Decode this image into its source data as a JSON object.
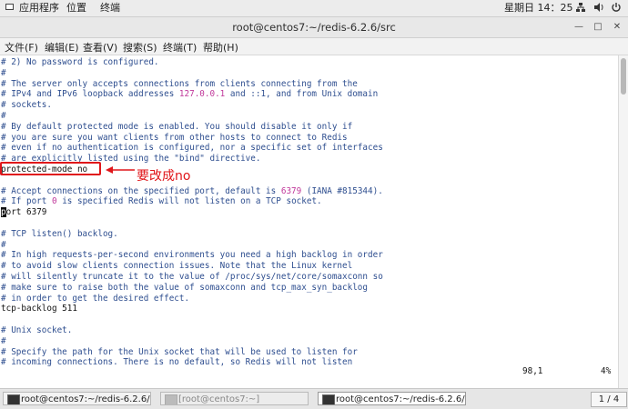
{
  "topbar": {
    "apps_label": "应用程序",
    "places_label": "位置",
    "terminal_label": "终端",
    "clock": "星期日 14：25"
  },
  "window": {
    "title": "root@centos7:~/redis-6.2.6/src"
  },
  "menu": [
    "文件(F)",
    "编辑(E)",
    "查看(V)",
    "搜索(S)",
    "终端(T)",
    "帮助(H)"
  ],
  "lines": [
    {
      "pre": "# 2) No password is configured.",
      "num": "",
      "post": ""
    },
    {
      "pre": "#",
      "num": "",
      "post": ""
    },
    {
      "pre": "# The server only accepts connections from clients connecting from the",
      "num": "",
      "post": ""
    },
    {
      "pre": "# IPv4 and IPv6 loopback addresses ",
      "num": "127.0.0.1",
      "post": " and ::1, and from Unix domain"
    },
    {
      "pre": "# sockets.",
      "num": "",
      "post": ""
    },
    {
      "pre": "#",
      "num": "",
      "post": ""
    },
    {
      "pre": "# By default protected mode is enabled. You should disable it only if",
      "num": "",
      "post": ""
    },
    {
      "pre": "# you are sure you want clients from other hosts to connect to Redis",
      "num": "",
      "post": ""
    },
    {
      "pre": "# even if no authentication is configured, nor a specific set of interfaces",
      "num": "",
      "post": ""
    },
    {
      "pre": "# are explicitly listed using the \"bind\" directive.",
      "num": "",
      "post": ""
    },
    {
      "pre": "protected-mode no",
      "num": "",
      "post": "",
      "black": true
    },
    {
      "pre": "",
      "num": "",
      "post": ""
    },
    {
      "pre": "# Accept connections on the specified port, default is ",
      "num": "6379",
      "post": " (IANA #815344)."
    },
    {
      "pre": "# If port ",
      "num": "0",
      "post": " is specified Redis will not listen on a TCP socket."
    },
    {
      "pre": "port 6379",
      "num": "",
      "post": "",
      "black": true,
      "cursor": true
    },
    {
      "pre": "",
      "num": "",
      "post": ""
    },
    {
      "pre": "# TCP listen() backlog.",
      "num": "",
      "post": ""
    },
    {
      "pre": "#",
      "num": "",
      "post": ""
    },
    {
      "pre": "# In high requests-per-second environments you need a high backlog in order",
      "num": "",
      "post": ""
    },
    {
      "pre": "# to avoid slow clients connection issues. Note that the Linux kernel",
      "num": "",
      "post": ""
    },
    {
      "pre": "# will silently truncate it to the value of /proc/sys/net/core/somaxconn so",
      "num": "",
      "post": ""
    },
    {
      "pre": "# make sure to raise both the value of somaxconn and tcp_max_syn_backlog",
      "num": "",
      "post": ""
    },
    {
      "pre": "# in order to get the desired effect.",
      "num": "",
      "post": ""
    },
    {
      "pre": "tcp-backlog 511",
      "num": "",
      "post": "",
      "black": true
    },
    {
      "pre": "",
      "num": "",
      "post": ""
    },
    {
      "pre": "# Unix socket.",
      "num": "",
      "post": ""
    },
    {
      "pre": "#",
      "num": "",
      "post": ""
    },
    {
      "pre": "# Specify the path for the Unix socket that will be used to listen for",
      "num": "",
      "post": ""
    },
    {
      "pre": "# incoming connections. There is no default, so Redis will not listen",
      "num": "",
      "post": ""
    }
  ],
  "status": {
    "position": "98,1",
    "percent": "4%"
  },
  "annotation": {
    "text": "要改成no",
    "color": "#e0161a"
  },
  "taskbar": {
    "tasks": [
      {
        "label": "root@centos7:~/redis-6.2.6/src",
        "state": "normal"
      },
      {
        "label": "[root@centos7:~]",
        "state": "dim"
      },
      {
        "label": "root@centos7:~/redis-6.2.6/src",
        "state": "active"
      }
    ],
    "pager": "1 / 4"
  },
  "colors": {
    "comment": "#2e4e8f",
    "number": "#c0379a",
    "highlight": "#e0161a"
  }
}
